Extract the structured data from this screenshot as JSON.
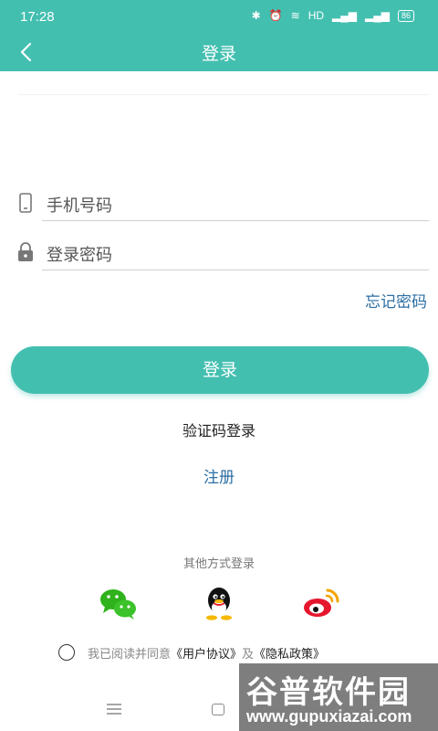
{
  "status_bar": {
    "time": "17:28",
    "network": "HD",
    "battery": "86"
  },
  "app_bar": {
    "title": "登录"
  },
  "form": {
    "phone_placeholder": "手机号码",
    "password_placeholder": "登录密码",
    "forgot_password": "忘记密码",
    "login_button": "登录",
    "sms_login": "验证码登录",
    "register": "注册"
  },
  "other_login": {
    "label": "其他方式登录",
    "providers": [
      "wechat",
      "qq",
      "weibo"
    ]
  },
  "agreement": {
    "prefix": "我已阅读并同意",
    "user_agreement": "《用户协议》",
    "and": "及",
    "privacy_policy": "《隐私政策》"
  },
  "watermark": {
    "title": "谷普软件园",
    "url": "www.gupuxiazai.com"
  },
  "colors": {
    "accent": "#43bfb0",
    "link": "#2b6ea3"
  }
}
